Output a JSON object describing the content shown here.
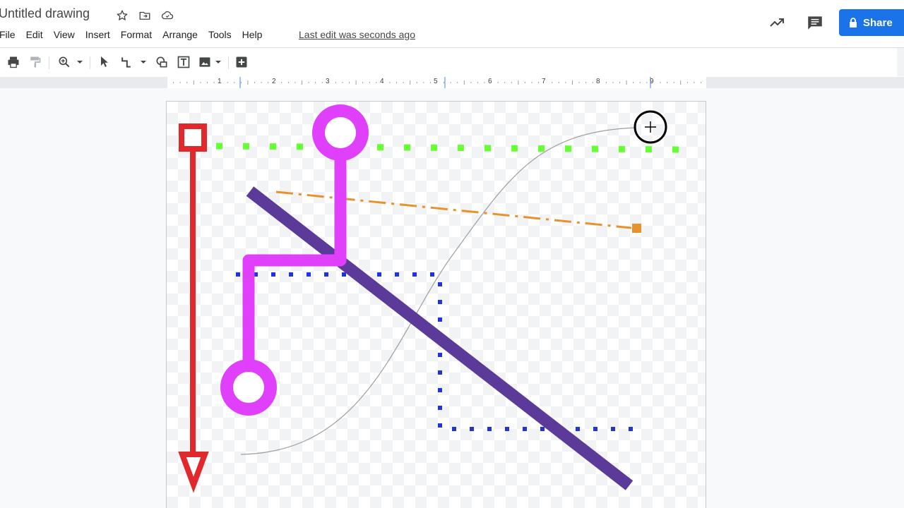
{
  "document": {
    "title": "Untitled drawing"
  },
  "menu": [
    "File",
    "Edit",
    "View",
    "Insert",
    "Format",
    "Arrange",
    "Tools",
    "Help"
  ],
  "status": {
    "last_edit": "Last edit was seconds ago"
  },
  "share": {
    "label": "Share"
  },
  "ruler": {
    "labels": [
      "1",
      "2",
      "3",
      "4",
      "5",
      "6",
      "7",
      "8",
      "9"
    ]
  },
  "icons": {
    "title_bar": [
      "star-icon",
      "move-to-folder-icon",
      "cloud-saved-icon"
    ],
    "toolbar": [
      "print-icon",
      "paint-format-icon",
      "zoom-icon",
      "select-icon",
      "line-icon",
      "shape-icon",
      "text-box-icon",
      "image-icon",
      "add-icon"
    ]
  },
  "colors": {
    "accent": "#1a73e8",
    "red_arrow": "#e0282d",
    "green_dotted": "#66ff33",
    "magenta_elbow": "#e040fb",
    "purple_line": "#5b3a9a",
    "orange_dashdot": "#e8922e",
    "blue_dotted": "#2233dd",
    "gray_curve": "#9e9e9e"
  }
}
